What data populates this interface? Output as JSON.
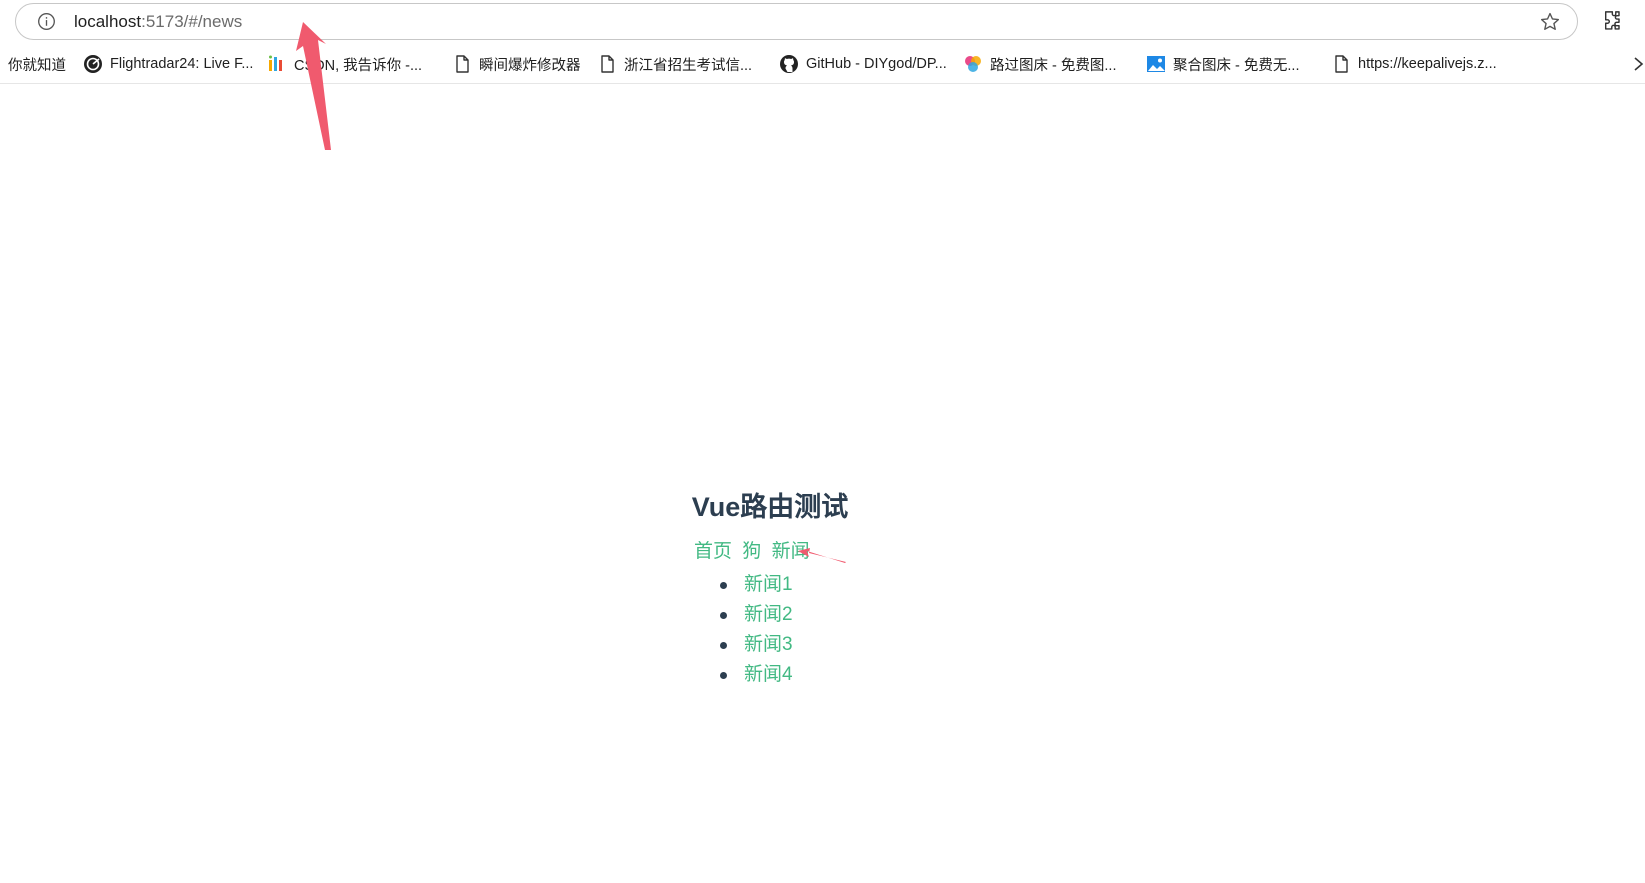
{
  "browser": {
    "url_host": "localhost",
    "url_rest": ":5173/#/news"
  },
  "bookmarks": [
    {
      "label": "你就知道",
      "icon": "none"
    },
    {
      "label": "Flightradar24: Live F...",
      "icon": "radar-icon"
    },
    {
      "label": "CSDN, 我告诉你 -...",
      "icon": "csdn-icon"
    },
    {
      "label": "瞬间爆炸修改器",
      "icon": "page-icon"
    },
    {
      "label": "浙江省招生考试信...",
      "icon": "page-icon"
    },
    {
      "label": "GitHub - DIYgod/DP...",
      "icon": "github-icon"
    },
    {
      "label": "路过图床 - 免费图...",
      "icon": "circles-icon"
    },
    {
      "label": "聚合图床 - 免费无...",
      "icon": "image-icon"
    },
    {
      "label": "https://keepalivejs.z...",
      "icon": "page-icon"
    }
  ],
  "app": {
    "title": "Vue路由测试",
    "nav": [
      {
        "label": "首页"
      },
      {
        "label": "狗"
      },
      {
        "label": "新闻"
      }
    ],
    "news": [
      {
        "label": "新闻1"
      },
      {
        "label": "新闻2"
      },
      {
        "label": "新闻3"
      },
      {
        "label": "新闻4"
      }
    ]
  },
  "colors": {
    "link": "#42b983",
    "text": "#2c3e50",
    "annotation": "#f05a6e"
  }
}
